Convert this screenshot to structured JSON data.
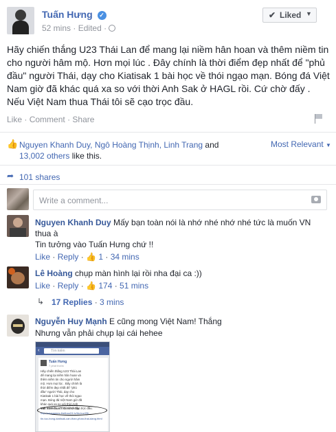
{
  "post": {
    "author": "Tuấn Hưng",
    "time": "52 mins",
    "edited": "Edited",
    "separator": "·",
    "liked_button": "Liked",
    "body": "Hãy chiến thắng U23 Thái Lan để mang lại niềm hân hoan và thêm niềm tin cho người hâm mộ. Hơn mọi lúc . Đây chính là thời điểm đẹp nhất để \"phủ đầu\" người Thái, dạy cho Kiatisak 1 bài học về thói ngạo mạn. Bóng đá Việt Nam giờ đã khác quá xa so với thời Anh Sak ở HAGL rồi. Cứ chờ đấy . Nếu Việt Nam thua Thái tôi sẽ cạo trọc đầu.",
    "actions": {
      "like": "Like",
      "comment": "Comment",
      "share": "Share",
      "dot": "·"
    }
  },
  "likes": {
    "names": "Nguyen Khanh Duy, Ngô Hoàng Thịnh, Linh Trang",
    "and": "and",
    "others": "13,002 others",
    "suffix": "like this.",
    "sort": "Most Relevant"
  },
  "shares": {
    "label": "101 shares"
  },
  "composer": {
    "placeholder": "Write a comment..."
  },
  "comments": [
    {
      "author": "Nguyen Khanh Duy",
      "text_line1": "Mấy bạn toàn nói là nhớ nhé nhớ nhé tức là muốn VN thua à",
      "text_line2": "Tin tưởng vào Tuấn Hưng chứ !!",
      "like": "Like",
      "reply": "Reply",
      "likes": "1",
      "time": "34 mins"
    },
    {
      "author": "Lê Hoàng",
      "text_line1": "chụp màn hình lại rồi nha đại ca :))",
      "like": "Like",
      "reply": "Reply",
      "likes": "174",
      "time": "51 mins"
    },
    {
      "replies": "17 Replies",
      "time": "3 mins"
    },
    {
      "author": "Nguyễn Huy Mạnh",
      "text_line1": "E cũng mong Việt Nam! Thắng",
      "text_line2": "Nhưng vẫn phải chụp lại cái hehee"
    }
  ],
  "screenshot_thumb": {
    "search": "Tìm kiếm",
    "author": "Tuấn Hưng",
    "meta": "7 phút trước",
    "text": "Hãy chiến thắng U23 Thái Lan để mang lại niềm hân hoan và thêm niềm tin cho người hâm mộ. Hơn mọi lúc . Đây chính là thời điểm đẹp nhất để \"phủ đầu\" người Thái, dạy cho Kiatisak 1 bài học về thói ngạo mạn. Bóng đá Việt Nam giờ đã khác quá xa so với thời Anh Sak ở HAGL rồi. Cứ chờ đấy .",
    "highlight": "Việt Nam thua Thái tôi sẽ cạo trọc đầu.",
    "link1": "http://seagames.thethao24.tv/tin-tuc/29/...",
    "link2": "tin-tuc-bong-kiatisak-can-than-phan-thai-dang.html"
  }
}
